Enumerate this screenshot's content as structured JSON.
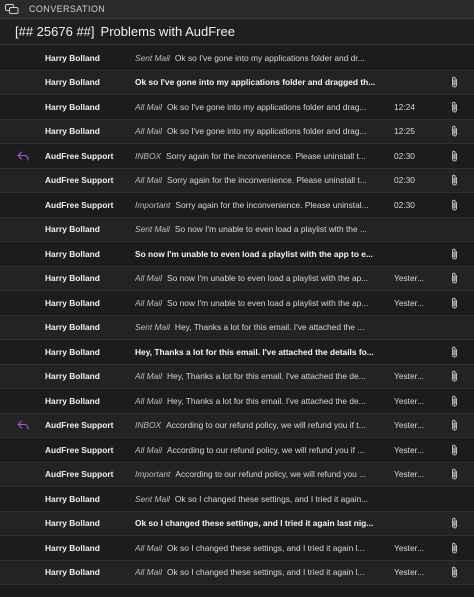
{
  "header": {
    "section_label": "CONVERSATION",
    "icon": "conversation-icon"
  },
  "subject": {
    "tag": "[## 25676 ##]",
    "title": "Problems with AudFree"
  },
  "colors": {
    "background": "#1c1c1e",
    "reply_accent": "#a25fd0",
    "text": "#e8e8e8"
  },
  "messages": [
    {
      "sender": "Harry Bolland",
      "folder": "Sent Mail",
      "snippet": "Ok so I've gone into my applications folder and dr...",
      "time": "",
      "attachment": false,
      "bold": false,
      "replied": false
    },
    {
      "sender": "Harry Bolland",
      "folder": "",
      "snippet": "Ok so I've gone into my applications folder and dragged th...",
      "time": "",
      "attachment": true,
      "bold": true,
      "replied": false
    },
    {
      "sender": "Harry Bolland",
      "folder": "All Mail",
      "snippet": "Ok so I've gone into my applications folder and drag...",
      "time": "12:24",
      "attachment": true,
      "bold": false,
      "replied": false
    },
    {
      "sender": "Harry Bolland",
      "folder": "All Mail",
      "snippet": "Ok so I've gone into my applications folder and drag...",
      "time": "12:25",
      "attachment": true,
      "bold": false,
      "replied": false
    },
    {
      "sender": "AudFree Support",
      "folder": "INBOX",
      "snippet": "Sorry again for the inconvenience. Please uninstall t...",
      "time": "02:30",
      "attachment": true,
      "bold": false,
      "replied": true
    },
    {
      "sender": "AudFree Support",
      "folder": "All Mail",
      "snippet": "Sorry again for the inconvenience. Please uninstall t...",
      "time": "02:30",
      "attachment": true,
      "bold": false,
      "replied": false
    },
    {
      "sender": "AudFree Support",
      "folder": "Important",
      "snippet": "Sorry again for the inconvenience. Please uninstal...",
      "time": "02:30",
      "attachment": true,
      "bold": false,
      "replied": false
    },
    {
      "sender": "Harry Bolland",
      "folder": "Sent Mail",
      "snippet": "So now I'm unable to even load a playlist with the ...",
      "time": "",
      "attachment": false,
      "bold": false,
      "replied": false
    },
    {
      "sender": "Harry Bolland",
      "folder": "",
      "snippet": "So now I'm unable to even load a playlist with the app to e...",
      "time": "",
      "attachment": true,
      "bold": true,
      "replied": false
    },
    {
      "sender": "Harry Bolland",
      "folder": "All Mail",
      "snippet": "So now I'm unable to even load a playlist with the ap...",
      "time": "Yester...",
      "attachment": true,
      "bold": false,
      "replied": false
    },
    {
      "sender": "Harry Bolland",
      "folder": "All Mail",
      "snippet": "So now I'm unable to even load a playlist with the ap...",
      "time": "Yester...",
      "attachment": true,
      "bold": false,
      "replied": false
    },
    {
      "sender": "Harry Bolland",
      "folder": "Sent Mail",
      "snippet": "Hey, Thanks a lot for this email. I've attached the ...",
      "time": "",
      "attachment": false,
      "bold": false,
      "replied": false
    },
    {
      "sender": "Harry Bolland",
      "folder": "",
      "snippet": "Hey, Thanks a lot for this email. I've attached the details fo...",
      "time": "",
      "attachment": true,
      "bold": true,
      "replied": false
    },
    {
      "sender": "Harry Bolland",
      "folder": "All Mail",
      "snippet": "Hey, Thanks a lot for this email. I've attached the de...",
      "time": "Yester...",
      "attachment": true,
      "bold": false,
      "replied": false
    },
    {
      "sender": "Harry Bolland",
      "folder": "All Mail",
      "snippet": "Hey, Thanks a lot for this email. I've attached the de...",
      "time": "Yester...",
      "attachment": true,
      "bold": false,
      "replied": false
    },
    {
      "sender": "AudFree Support",
      "folder": "INBOX",
      "snippet": "According to our refund policy, we will refund you if t...",
      "time": "Yester...",
      "attachment": true,
      "bold": false,
      "replied": true
    },
    {
      "sender": "AudFree Support",
      "folder": "All Mail",
      "snippet": "According to our refund policy, we will refund you if ...",
      "time": "Yester...",
      "attachment": true,
      "bold": false,
      "replied": false
    },
    {
      "sender": "AudFree Support",
      "folder": "Important",
      "snippet": "According to our refund policy, we will refund you ...",
      "time": "Yester...",
      "attachment": true,
      "bold": false,
      "replied": false
    },
    {
      "sender": "Harry Bolland",
      "folder": "Sent Mail",
      "snippet": "Ok so I changed these settings, and I tried it again...",
      "time": "",
      "attachment": false,
      "bold": false,
      "replied": false
    },
    {
      "sender": "Harry Bolland",
      "folder": "",
      "snippet": "Ok so I changed these settings, and I tried it again last nig...",
      "time": "",
      "attachment": true,
      "bold": true,
      "replied": false
    },
    {
      "sender": "Harry Bolland",
      "folder": "All Mail",
      "snippet": "Ok so I changed these settings, and I tried it again l...",
      "time": "Yester...",
      "attachment": true,
      "bold": false,
      "replied": false
    },
    {
      "sender": "Harry Bolland",
      "folder": "All Mail",
      "snippet": "Ok so I changed these settings, and I tried it again l...",
      "time": "Yester...",
      "attachment": true,
      "bold": false,
      "replied": false
    }
  ]
}
